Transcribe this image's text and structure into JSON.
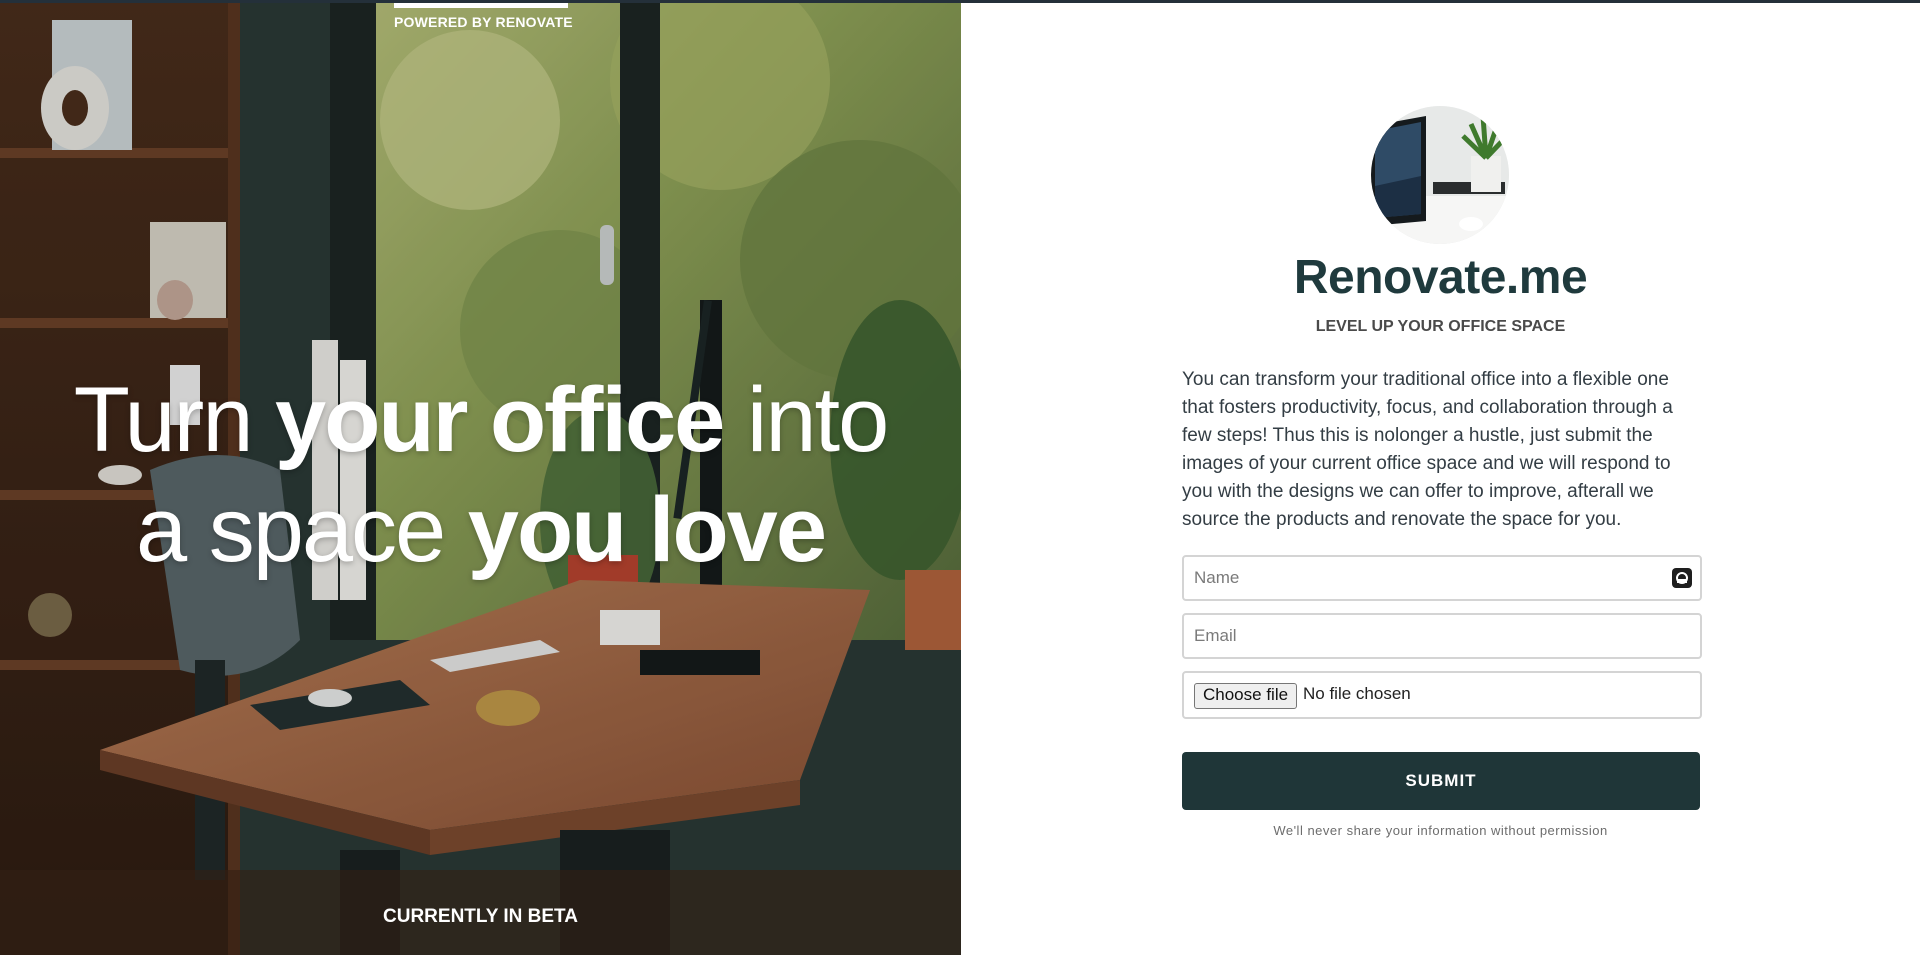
{
  "hero": {
    "powered_by": "POWERED BY RENOVATE",
    "headline": {
      "w1": "Turn ",
      "w2": "your office",
      "w3": " into",
      "w4": "a space ",
      "w5": "you love"
    },
    "beta_label": "CURRENTLY IN BETA"
  },
  "panel": {
    "brand": "Renovate.me",
    "tagline": "LEVEL UP YOUR OFFICE SPACE",
    "description": "You can transform your traditional office into a flexible one that fosters productivity, focus, and collaboration through a few steps! Thus this is nolonger a hustle, just submit the images of your current office space and we will respond to you with the designs we can offer to improve, afterall we source the products and renovate the space for you.",
    "form": {
      "name_placeholder": "Name",
      "email_placeholder": "Email",
      "file_button_label": "Choose file",
      "file_status": "No file chosen",
      "submit_label": "SUBMIT",
      "privacy_note": "We'll never share your information without permission"
    }
  },
  "colors": {
    "brand": "#1f3a3d",
    "submit_bg": "#1f3638",
    "topbar": "#24303a"
  },
  "icons": {
    "password_manager": "password-manager-icon"
  }
}
